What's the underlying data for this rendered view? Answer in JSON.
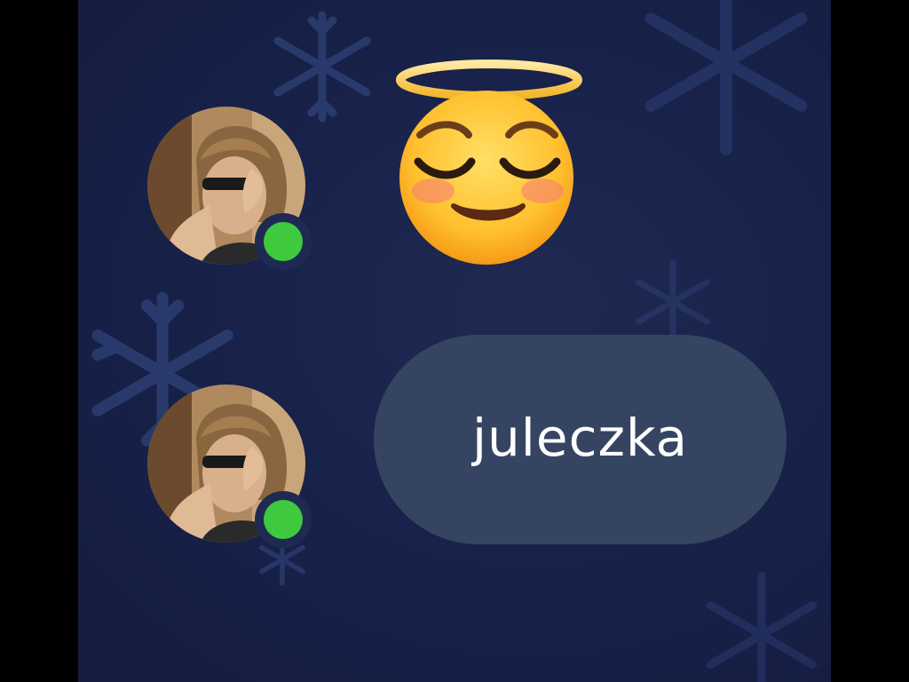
{
  "colors": {
    "background": "#18224a",
    "bubble": "#354461",
    "status_online": "#3ec93e",
    "snowflake": "#3b5290"
  },
  "messages": [
    {
      "type": "emoji",
      "emoji_icon": "smiling-face-with-halo-icon",
      "avatar_status": "online"
    },
    {
      "type": "text",
      "text": "juleczka",
      "avatar_status": "online"
    }
  ]
}
